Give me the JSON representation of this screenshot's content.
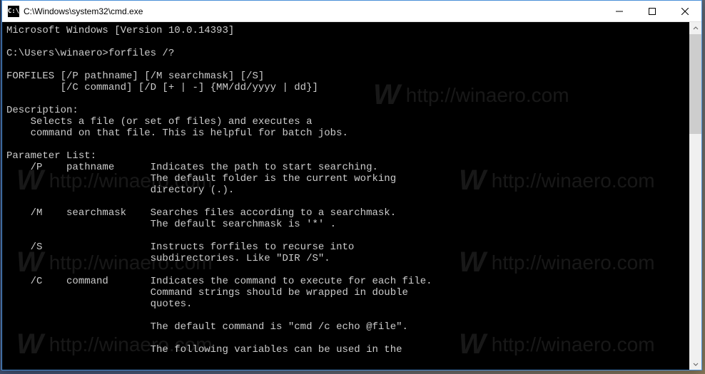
{
  "window": {
    "icon_text": "C:\\",
    "title": "C:\\Windows\\system32\\cmd.exe"
  },
  "console": {
    "lines": [
      "Microsoft Windows [Version 10.0.14393]",
      "",
      "C:\\Users\\winaero>forfiles /?",
      "",
      "FORFILES [/P pathname] [/M searchmask] [/S]",
      "         [/C command] [/D [+ | -] {MM/dd/yyyy | dd}]",
      "",
      "Description:",
      "    Selects a file (or set of files) and executes a",
      "    command on that file. This is helpful for batch jobs.",
      "",
      "Parameter List:",
      "    /P    pathname      Indicates the path to start searching.",
      "                        The default folder is the current working",
      "                        directory (.).",
      "",
      "    /M    searchmask    Searches files according to a searchmask.",
      "                        The default searchmask is '*' .",
      "",
      "    /S                  Instructs forfiles to recurse into",
      "                        subdirectories. Like \"DIR /S\".",
      "",
      "    /C    command       Indicates the command to execute for each file.",
      "                        Command strings should be wrapped in double",
      "                        quotes.",
      "",
      "                        The default command is \"cmd /c echo @file\".",
      "",
      "                        The following variables can be used in the"
    ]
  },
  "watermark": {
    "logo": "W",
    "text": "http://winaero.com"
  }
}
